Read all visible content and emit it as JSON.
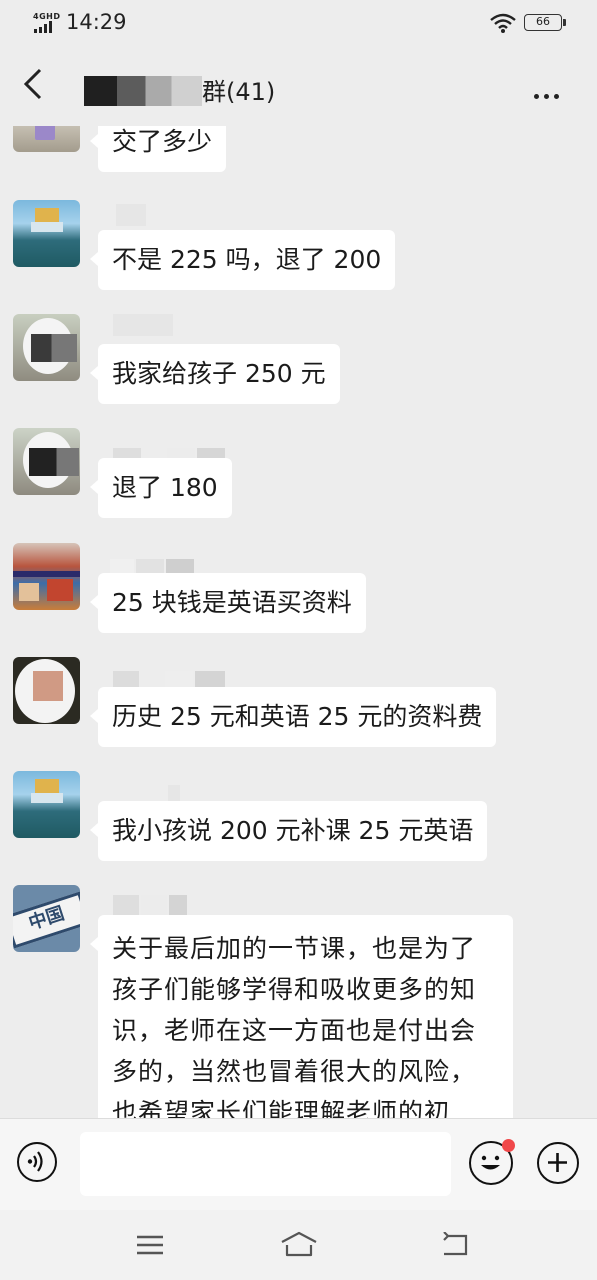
{
  "status_bar": {
    "network": "4GHD",
    "time": "14:29",
    "battery": "66"
  },
  "header": {
    "title_suffix": "群(41)"
  },
  "messages": [
    {
      "text": "交了多少"
    },
    {
      "text": "不是 225 吗，退了 200"
    },
    {
      "text": "我家给孩子 250 元"
    },
    {
      "text": "退了 180"
    },
    {
      "text": "25 块钱是英语买资料"
    },
    {
      "text": "历史 25 元和英语 25 元的资料费"
    },
    {
      "text": "我小孩说 200 元补课 25 元英语"
    },
    {
      "text": "关于最后加的一节课，也是为了孩子们能够学得和吸收更多的知识，老师在这一方面也是付出会多的，当然也冒着很大的风险，也希望家长们能理解老师的初衷，"
    }
  ],
  "avatars": [
    {
      "label": "中国"
    }
  ]
}
